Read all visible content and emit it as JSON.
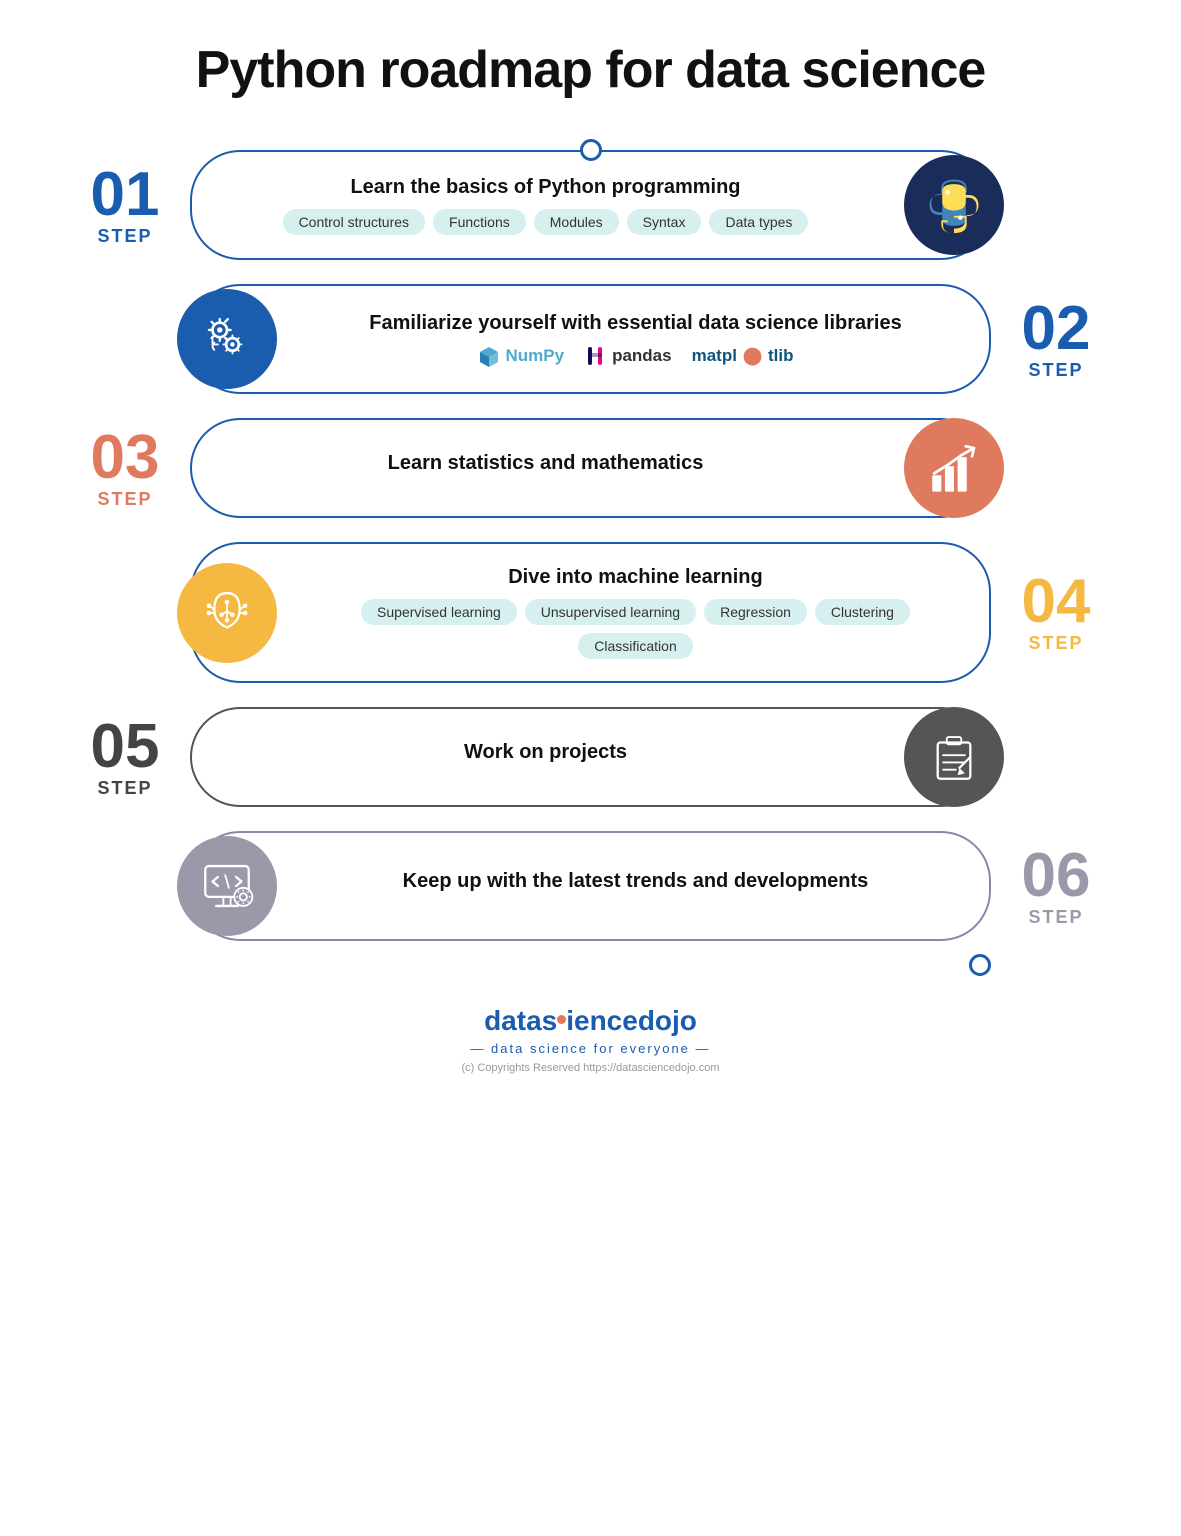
{
  "title": "Python roadmap for data science",
  "steps": [
    {
      "id": "step1",
      "number": "01",
      "label": "STEP",
      "color": "blue",
      "side": "left",
      "title": "Learn the basics of Python programming",
      "tags": [
        "Control structures",
        "Functions",
        "Modules",
        "Syntax",
        "Data types"
      ],
      "icon": "python",
      "iconBg": "#1a2d5a"
    },
    {
      "id": "step2",
      "number": "02",
      "label": "STEP",
      "color": "blue",
      "side": "right",
      "title": "Familiarize yourself with essential data science libraries",
      "libraries": [
        "NumPy",
        "pandas",
        "matplotlib"
      ],
      "icon": "gears",
      "iconBg": "#1a5cad"
    },
    {
      "id": "step3",
      "number": "03",
      "label": "STEP",
      "color": "orange",
      "side": "left",
      "title": "Learn statistics and mathematics",
      "tags": [],
      "icon": "chart",
      "iconBg": "#e07a5f"
    },
    {
      "id": "step4",
      "number": "04",
      "label": "STEP",
      "color": "gold",
      "side": "right",
      "title": "Dive into machine learning",
      "tags": [
        "Supervised learning",
        "Unsupervised learning",
        "Regression",
        "Clustering",
        "Classification"
      ],
      "icon": "ai",
      "iconBg": "#f5b942"
    },
    {
      "id": "step5",
      "number": "05",
      "label": "STEP",
      "color": "dark",
      "side": "left",
      "title": "Work on projects",
      "tags": [],
      "icon": "projects",
      "iconBg": "#555555"
    },
    {
      "id": "step6",
      "number": "06",
      "label": "STEP",
      "color": "mauve",
      "side": "right",
      "title": "Keep up with the latest trends and developments",
      "tags": [],
      "icon": "code",
      "iconBg": "#9999aa"
    }
  ],
  "logo": {
    "text1": "data",
    "text2": "science",
    "text3": "dojo",
    "tagline": "data science for everyone",
    "copyright": "(c) Copyrights Reserved  https://datasciencedojo.com"
  }
}
